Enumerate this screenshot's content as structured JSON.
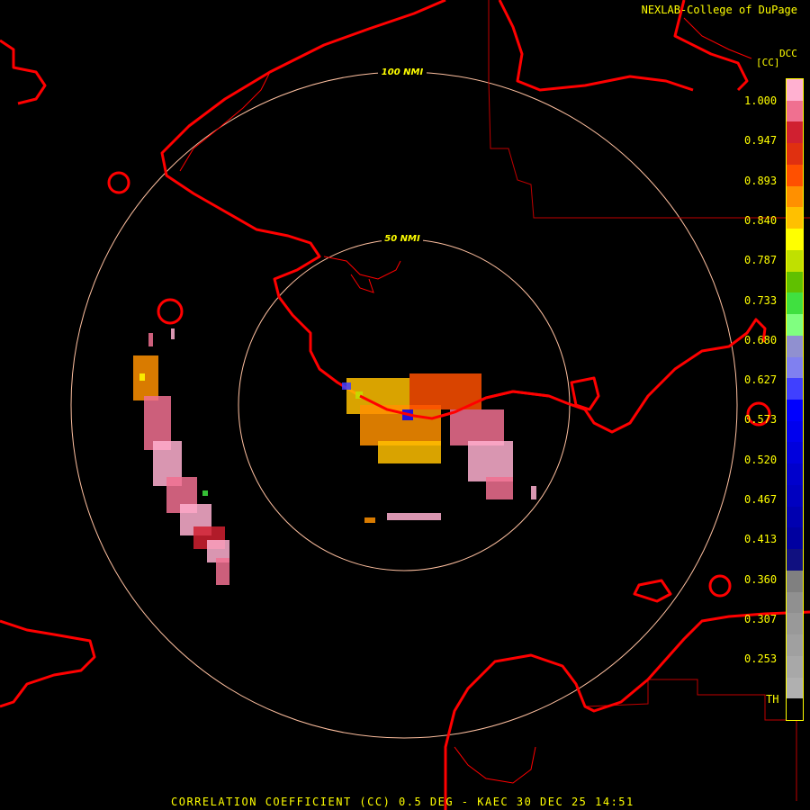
{
  "credit": "NEXLAB-College of DuPage",
  "product_code": "DCC",
  "unit_label": "[CC]",
  "colorbar": {
    "ticks": [
      "1.000",
      "0.947",
      "0.893",
      "0.840",
      "0.787",
      "0.733",
      "0.680",
      "0.627",
      "0.573",
      "0.520",
      "0.467",
      "0.413",
      "0.360",
      "0.307",
      "0.253",
      "TH"
    ],
    "colors": [
      "#ffb0d0",
      "#f07090",
      "#d02030",
      "#e03010",
      "#ff5000",
      "#ff9000",
      "#ffc000",
      "#ffff00",
      "#c0e000",
      "#60c000",
      "#40e040",
      "#80ff80",
      "#9090d0",
      "#8080f0",
      "#4040ff",
      "#0000ff",
      "#0000ee",
      "#0000dd",
      "#0000cc",
      "#0000c0",
      "#0000b0",
      "#0000a0",
      "#101080",
      "#808080",
      "#909090",
      "#999999",
      "#a0a0a0",
      "#a8a8a8",
      "#b0b0b0",
      "#000000"
    ]
  },
  "rings": [
    {
      "label": "100 NMI"
    },
    {
      "label": "50 NMI"
    }
  ],
  "footer": "CORRELATION COEFFICIENT (CC) 0.5 DEG - KAEC 30 DEC 25 14:51",
  "colors": {
    "map_lines": "#ff0000",
    "ring": "#ffc0a0",
    "text": "#ffff00"
  }
}
